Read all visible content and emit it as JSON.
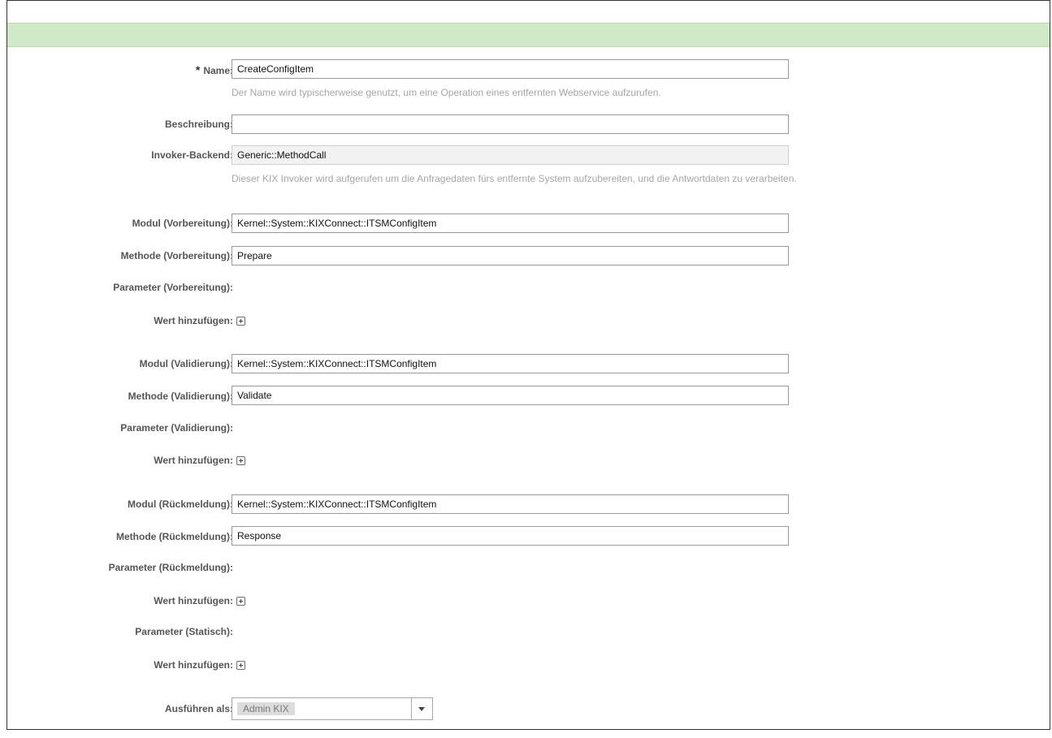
{
  "form": {
    "name": {
      "required_mark": "*",
      "label": "Name:",
      "value": "CreateConfigItem",
      "hint": "Der Name wird typischerweise genutzt, um eine Operation eines entfernten Webservice aufzurufen."
    },
    "description": {
      "label": "Beschreibung:",
      "value": ""
    },
    "invoker_backend": {
      "label": "Invoker-Backend:",
      "value": "Generic::MethodCall",
      "hint": "Dieser KIX Invoker wird aufgerufen um die Anfragedaten fürs entfernte System aufzubereiten, und die Antwortdaten zu verarbeiten."
    },
    "prepare": {
      "module_label": "Modul (Vorbereitung):",
      "module_value": "Kernel::System::KIXConnect::ITSMConfigItem",
      "method_label": "Methode (Vorbereitung):",
      "method_value": "Prepare",
      "params_label": "Parameter (Vorbereitung):",
      "add_label": "Wert hinzufügen:"
    },
    "validate": {
      "module_label": "Modul (Validierung):",
      "module_value": "Kernel::System::KIXConnect::ITSMConfigItem",
      "method_label": "Methode (Validierung):",
      "method_value": "Validate",
      "params_label": "Parameter (Validierung):",
      "add_label": "Wert hinzufügen:"
    },
    "response": {
      "module_label": "Modul (Rückmeldung):",
      "module_value": "Kernel::System::KIXConnect::ITSMConfigItem",
      "method_label": "Methode (Rückmeldung):",
      "method_value": "Response",
      "params_label": "Parameter (Rückmeldung):",
      "add_label": "Wert hinzufügen:"
    },
    "static": {
      "params_label": "Parameter (Statisch):",
      "add_label": "Wert hinzufügen:"
    },
    "run_as": {
      "label": "Ausführen als:",
      "value": "Admin KIX"
    }
  },
  "icons": {
    "add": "plus-square-icon",
    "dropdown": "chevron-down-icon"
  },
  "colors": {
    "header_bar": "#cfeac4",
    "hint_text": "#a6a6a6"
  }
}
